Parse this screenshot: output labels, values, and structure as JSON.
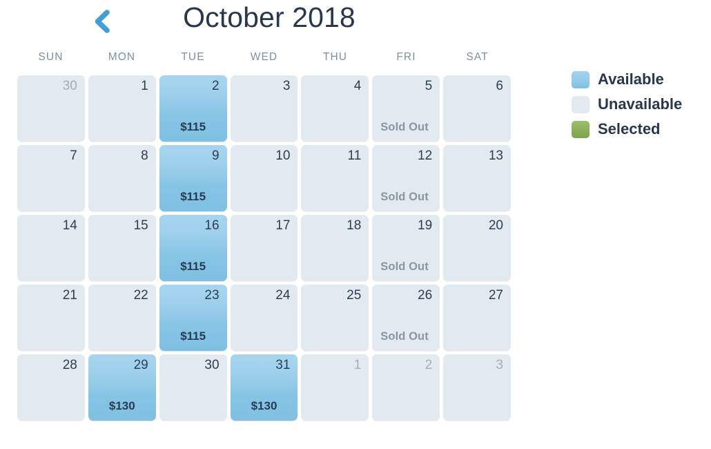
{
  "header": {
    "title": "October 2018",
    "prev_icon": "chevron-left-icon",
    "prev_label": "Previous month"
  },
  "weekdays": [
    "SUN",
    "MON",
    "TUE",
    "WED",
    "THU",
    "FRI",
    "SAT"
  ],
  "legend": {
    "items": [
      {
        "label": "Available",
        "state": "available",
        "color": "#8fc8e6"
      },
      {
        "label": "Unavailable",
        "state": "unavailable",
        "color": "#e2eaef"
      },
      {
        "label": "Selected",
        "state": "selected",
        "color": "#8fb463"
      }
    ]
  },
  "calendar": {
    "month": "October",
    "year": "2018",
    "days": [
      {
        "number": "30",
        "state": "unavailable",
        "outside": true,
        "price": "",
        "status": ""
      },
      {
        "number": "1",
        "state": "unavailable",
        "outside": false,
        "price": "",
        "status": ""
      },
      {
        "number": "2",
        "state": "available",
        "outside": false,
        "price": "$115",
        "status": ""
      },
      {
        "number": "3",
        "state": "unavailable",
        "outside": false,
        "price": "",
        "status": ""
      },
      {
        "number": "4",
        "state": "unavailable",
        "outside": false,
        "price": "",
        "status": ""
      },
      {
        "number": "5",
        "state": "unavailable",
        "outside": false,
        "price": "",
        "status": "Sold Out"
      },
      {
        "number": "6",
        "state": "unavailable",
        "outside": false,
        "price": "",
        "status": ""
      },
      {
        "number": "7",
        "state": "unavailable",
        "outside": false,
        "price": "",
        "status": ""
      },
      {
        "number": "8",
        "state": "unavailable",
        "outside": false,
        "price": "",
        "status": ""
      },
      {
        "number": "9",
        "state": "available",
        "outside": false,
        "price": "$115",
        "status": ""
      },
      {
        "number": "10",
        "state": "unavailable",
        "outside": false,
        "price": "",
        "status": ""
      },
      {
        "number": "11",
        "state": "unavailable",
        "outside": false,
        "price": "",
        "status": ""
      },
      {
        "number": "12",
        "state": "unavailable",
        "outside": false,
        "price": "",
        "status": "Sold Out"
      },
      {
        "number": "13",
        "state": "unavailable",
        "outside": false,
        "price": "",
        "status": ""
      },
      {
        "number": "14",
        "state": "unavailable",
        "outside": false,
        "price": "",
        "status": ""
      },
      {
        "number": "15",
        "state": "unavailable",
        "outside": false,
        "price": "",
        "status": ""
      },
      {
        "number": "16",
        "state": "available",
        "outside": false,
        "price": "$115",
        "status": ""
      },
      {
        "number": "17",
        "state": "unavailable",
        "outside": false,
        "price": "",
        "status": ""
      },
      {
        "number": "18",
        "state": "unavailable",
        "outside": false,
        "price": "",
        "status": ""
      },
      {
        "number": "19",
        "state": "unavailable",
        "outside": false,
        "price": "",
        "status": "Sold Out"
      },
      {
        "number": "20",
        "state": "unavailable",
        "outside": false,
        "price": "",
        "status": ""
      },
      {
        "number": "21",
        "state": "unavailable",
        "outside": false,
        "price": "",
        "status": ""
      },
      {
        "number": "22",
        "state": "unavailable",
        "outside": false,
        "price": "",
        "status": ""
      },
      {
        "number": "23",
        "state": "available",
        "outside": false,
        "price": "$115",
        "status": ""
      },
      {
        "number": "24",
        "state": "unavailable",
        "outside": false,
        "price": "",
        "status": ""
      },
      {
        "number": "25",
        "state": "unavailable",
        "outside": false,
        "price": "",
        "status": ""
      },
      {
        "number": "26",
        "state": "unavailable",
        "outside": false,
        "price": "",
        "status": "Sold Out"
      },
      {
        "number": "27",
        "state": "unavailable",
        "outside": false,
        "price": "",
        "status": ""
      },
      {
        "number": "28",
        "state": "unavailable",
        "outside": false,
        "price": "",
        "status": ""
      },
      {
        "number": "29",
        "state": "available",
        "outside": false,
        "price": "$130",
        "status": ""
      },
      {
        "number": "30",
        "state": "unavailable",
        "outside": false,
        "price": "",
        "status": ""
      },
      {
        "number": "31",
        "state": "available",
        "outside": false,
        "price": "$130",
        "status": ""
      },
      {
        "number": "1",
        "state": "unavailable",
        "outside": true,
        "price": "",
        "status": ""
      },
      {
        "number": "2",
        "state": "unavailable",
        "outside": true,
        "price": "",
        "status": ""
      },
      {
        "number": "3",
        "state": "unavailable",
        "outside": true,
        "price": "",
        "status": ""
      }
    ]
  }
}
